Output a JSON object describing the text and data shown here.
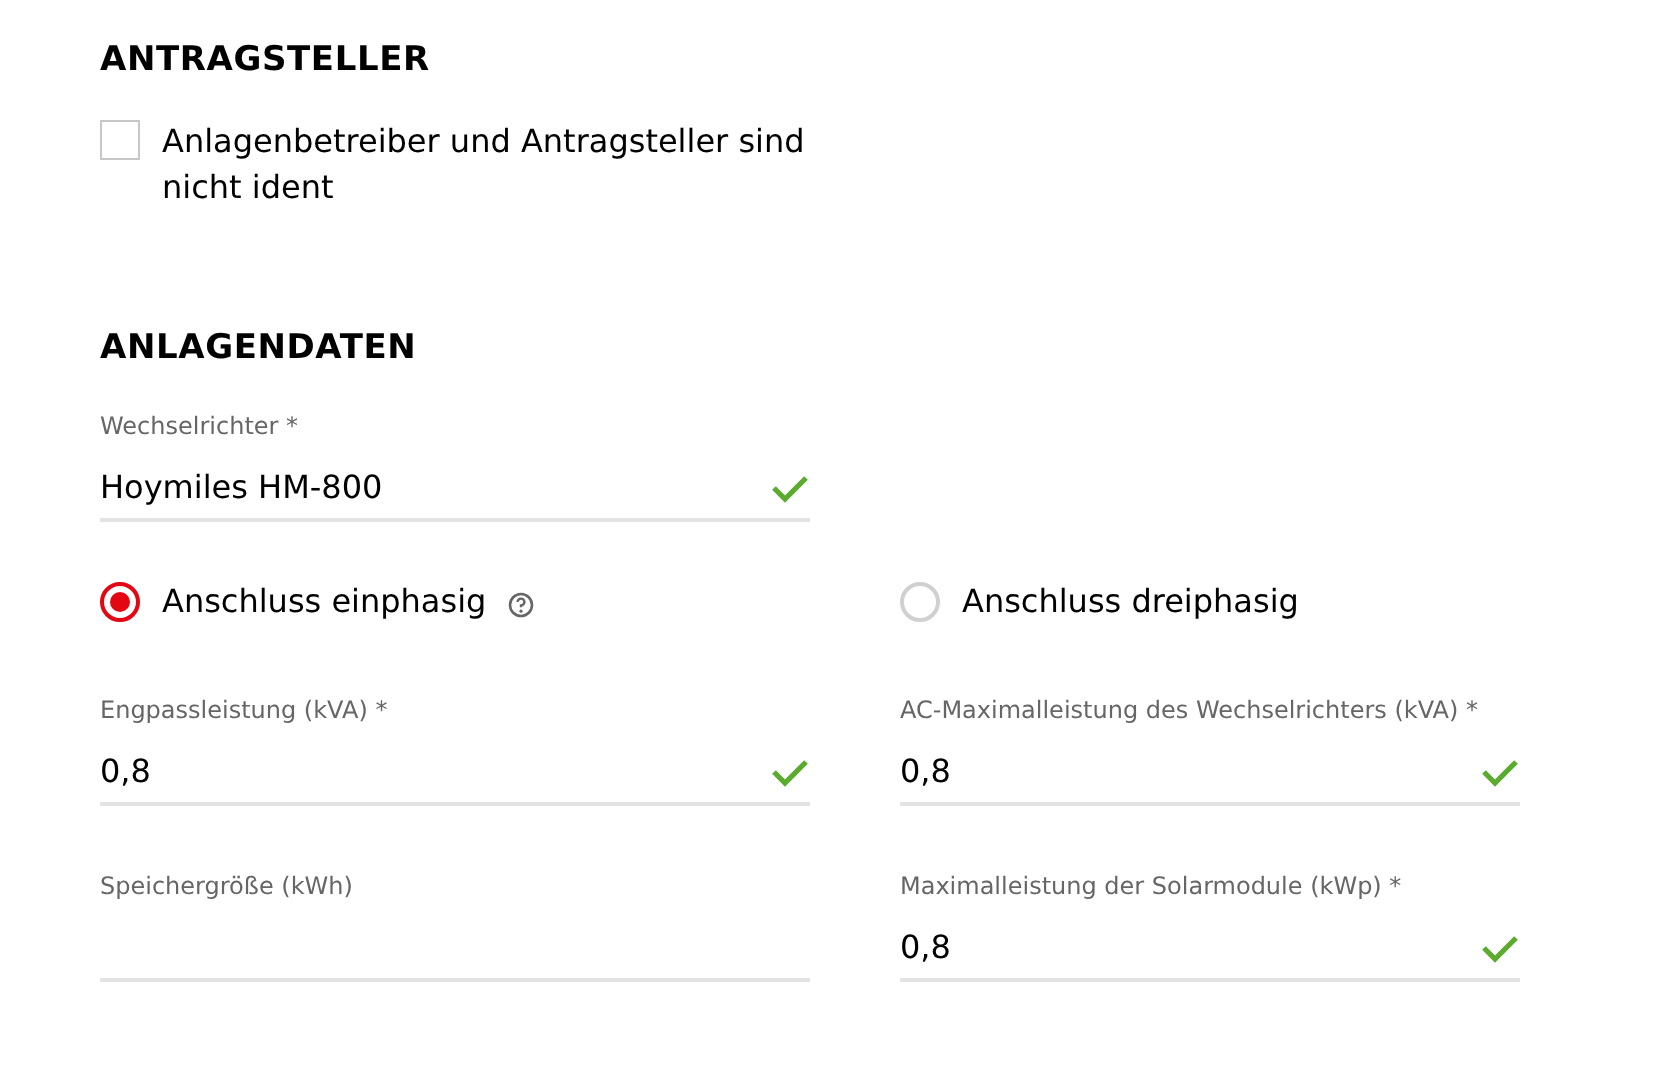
{
  "sections": [
    {
      "title": "ANTRAGSTELLER"
    },
    {
      "title": "ANLAGENDATEN"
    }
  ],
  "applicant_checkbox": {
    "label": "Anlagenbetreiber und Antragsteller sind nicht ident",
    "checked": false
  },
  "inverter": {
    "label": "Wechselrichter *",
    "value": "Hoymiles HM-800",
    "valid": true
  },
  "connection": [
    {
      "label": "Anschluss einphasig",
      "selected": true,
      "help": true
    },
    {
      "label": "Anschluss dreiphasig",
      "selected": false,
      "help": false
    }
  ],
  "fields": [
    {
      "label": "Engpassleistung (kVA) *",
      "value": "0,8",
      "valid": true
    },
    {
      "label": "AC-Maximalleistung des Wechselrichters (kVA) *",
      "value": "0,8",
      "valid": true
    },
    {
      "label": "Speichergröße (kWh)",
      "valid": false
    },
    {
      "label": "Maximalleistung der Solarmodule (kWp) *",
      "value": "0,8",
      "valid": true
    }
  ]
}
